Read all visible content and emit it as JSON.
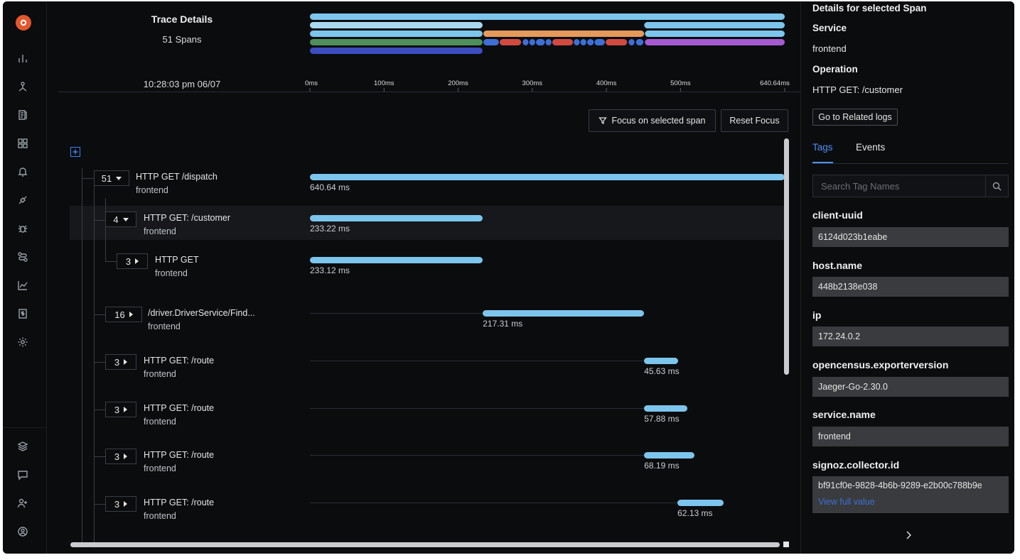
{
  "colors": {
    "background": "#0b0c0e",
    "span_bar": "#7cc5ed",
    "accent_blue": "#4f8ff7",
    "mini": {
      "light_blue": "#7cc5ed",
      "pale_blue": "#a9d8f0",
      "orange": "#e39a5a",
      "green": "#4e8f5c",
      "blue": "#3e6fd6",
      "red": "#d04a40",
      "purple": "#a65ad0",
      "navy": "#3b4dbf"
    }
  },
  "sidebar": {
    "logo": "signoz-logo-icon",
    "icons": [
      "bar-chart-icon",
      "services-icon",
      "logs-icon",
      "dashboard-grid-icon",
      "alerts-bell-icon",
      "plug-icon",
      "bug-icon",
      "route-icon",
      "line-chart-icon",
      "billing-icon",
      "settings-gear-icon"
    ],
    "bottom_icons": [
      "layers-icon",
      "chat-icon",
      "invite-user-icon",
      "user-profile-icon"
    ]
  },
  "header": {
    "title": "Trace Details",
    "span_count": "51 Spans",
    "timestamp": "10:28:03 pm 06/07",
    "ticks": [
      "0ms",
      "100ms",
      "200ms",
      "300ms",
      "400ms",
      "500ms",
      "640.64ms"
    ]
  },
  "toolbar": {
    "focus_label": "Focus on selected span",
    "reset_label": "Reset Focus"
  },
  "spans": [
    {
      "count": "51",
      "expanded": true,
      "name": "HTTP GET /dispatch",
      "service": "frontend",
      "duration": "640.64 ms",
      "start": 0,
      "dur": 640.64
    },
    {
      "count": "4",
      "expanded": true,
      "name": "HTTP GET: /customer",
      "service": "frontend",
      "duration": "233.22 ms",
      "start": 0,
      "dur": 233.22,
      "selected": true
    },
    {
      "count": "3",
      "expanded": false,
      "name": "HTTP GET",
      "service": "frontend",
      "duration": "233.12 ms",
      "start": 0,
      "dur": 233.12
    },
    {
      "count": "16",
      "expanded": false,
      "name": "/driver.DriverService/Find...",
      "service": "frontend",
      "duration": "217.31 ms",
      "start": 233.3,
      "dur": 217.31
    },
    {
      "count": "3",
      "expanded": false,
      "name": "HTTP GET: /route",
      "service": "frontend",
      "duration": "45.63 ms",
      "start": 451,
      "dur": 45.63
    },
    {
      "count": "3",
      "expanded": false,
      "name": "HTTP GET: /route",
      "service": "frontend",
      "duration": "57.88 ms",
      "start": 451,
      "dur": 57.88
    },
    {
      "count": "3",
      "expanded": false,
      "name": "HTTP GET: /route",
      "service": "frontend",
      "duration": "68.19 ms",
      "start": 451,
      "dur": 68.19
    },
    {
      "count": "3",
      "expanded": false,
      "name": "HTTP GET: /route",
      "service": "frontend",
      "duration": "62.13 ms",
      "start": 496,
      "dur": 62.13
    }
  ],
  "panel": {
    "title": "Details for selected Span",
    "service_heading": "Service",
    "service_value": "frontend",
    "operation_heading": "Operation",
    "operation_value": "HTTP GET: /customer",
    "logs_button": "Go to Related logs",
    "tabs": [
      "Tags",
      "Events"
    ],
    "search_placeholder": "Search Tag Names",
    "tags": [
      {
        "key": "client-uuid",
        "value": "6124d023b1eabe"
      },
      {
        "key": "host.name",
        "value": "448b2138e038"
      },
      {
        "key": "ip",
        "value": "172.24.0.2"
      },
      {
        "key": "opencensus.exporterversion",
        "value": "Jaeger-Go-2.30.0"
      },
      {
        "key": "service.name",
        "value": "frontend"
      },
      {
        "key": "signoz.collector.id",
        "value": "bf91cf0e-9828-4b6b-9289-e2b00c788b9e"
      }
    ],
    "view_full": "View full value"
  }
}
